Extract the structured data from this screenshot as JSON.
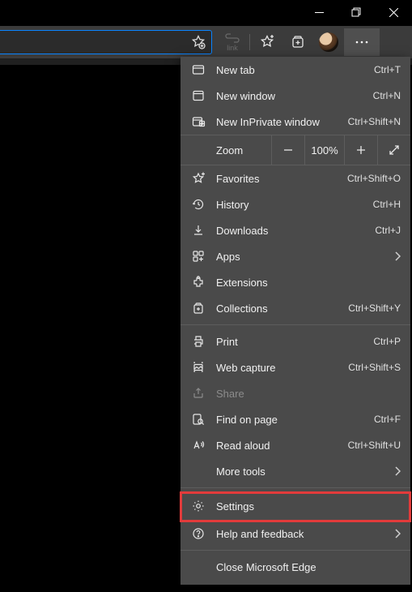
{
  "caption": {
    "minimize": "minimize",
    "maximize": "maximize",
    "close": "close"
  },
  "toolbar": {
    "link_caption": "link"
  },
  "menu": {
    "new_tab": {
      "label": "New tab",
      "shortcut": "Ctrl+T"
    },
    "new_window": {
      "label": "New window",
      "shortcut": "Ctrl+N"
    },
    "new_inprivate": {
      "label": "New InPrivate window",
      "shortcut": "Ctrl+Shift+N"
    },
    "zoom": {
      "label": "Zoom",
      "value": "100%"
    },
    "favorites": {
      "label": "Favorites",
      "shortcut": "Ctrl+Shift+O"
    },
    "history": {
      "label": "History",
      "shortcut": "Ctrl+H"
    },
    "downloads": {
      "label": "Downloads",
      "shortcut": "Ctrl+J"
    },
    "apps": {
      "label": "Apps"
    },
    "extensions": {
      "label": "Extensions"
    },
    "collections": {
      "label": "Collections",
      "shortcut": "Ctrl+Shift+Y"
    },
    "print": {
      "label": "Print",
      "shortcut": "Ctrl+P"
    },
    "web_capture": {
      "label": "Web capture",
      "shortcut": "Ctrl+Shift+S"
    },
    "share": {
      "label": "Share"
    },
    "find": {
      "label": "Find on page",
      "shortcut": "Ctrl+F"
    },
    "read_aloud": {
      "label": "Read aloud",
      "shortcut": "Ctrl+Shift+U"
    },
    "more_tools": {
      "label": "More tools"
    },
    "settings": {
      "label": "Settings"
    },
    "help": {
      "label": "Help and feedback"
    },
    "close_edge": {
      "label": "Close Microsoft Edge"
    }
  }
}
